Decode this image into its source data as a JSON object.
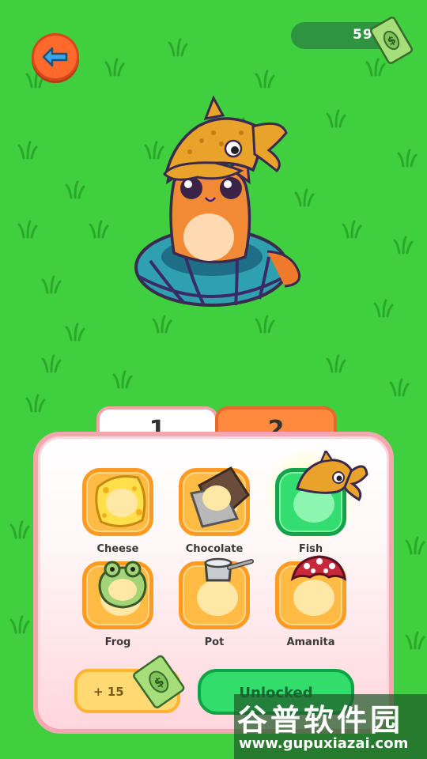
{
  "currency": {
    "amount": "59",
    "icon": "cash-bill-icon"
  },
  "tabs": [
    {
      "label": "1",
      "active": true
    },
    {
      "label": "2",
      "active": false
    }
  ],
  "items": [
    {
      "label": "Cheese",
      "icon": "cheese-icon",
      "selected": false
    },
    {
      "label": "Chocolate",
      "icon": "chocolate-icon",
      "selected": false
    },
    {
      "label": "Fish",
      "icon": "fish-hat-icon",
      "selected": true
    },
    {
      "label": "Frog",
      "icon": "frog-hat-icon",
      "selected": false
    },
    {
      "label": "Pot",
      "icon": "pot-icon",
      "selected": false
    },
    {
      "label": "Amanita",
      "icon": "mushroom-icon",
      "selected": false
    }
  ],
  "buttons": {
    "earn": "+ 15",
    "unlocked": "Unlocked"
  },
  "watermark": {
    "chinese": "谷普软件园",
    "url": "www.gupuxiazai.com"
  },
  "colors": {
    "grass": "#3fcf3f",
    "panel_border": "#f4a7b1",
    "selected_tile": "#33dd70",
    "tile": "#ffbb44"
  }
}
